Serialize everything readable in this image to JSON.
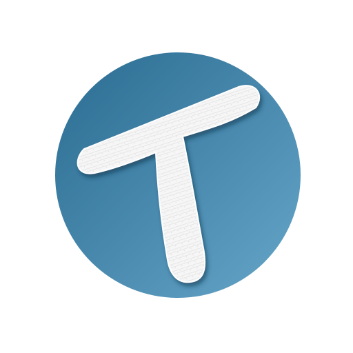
{
  "logo": {
    "icon": "brush-t-logo-icon",
    "colors": {
      "page_background": "#ffffff",
      "circle_dark": "#2a6b91",
      "circle_light": "#66a6c9",
      "letter_fill": "#f6f6f6",
      "letter_texture": "#d8d8d8",
      "shadow": "#0f2f45"
    }
  }
}
